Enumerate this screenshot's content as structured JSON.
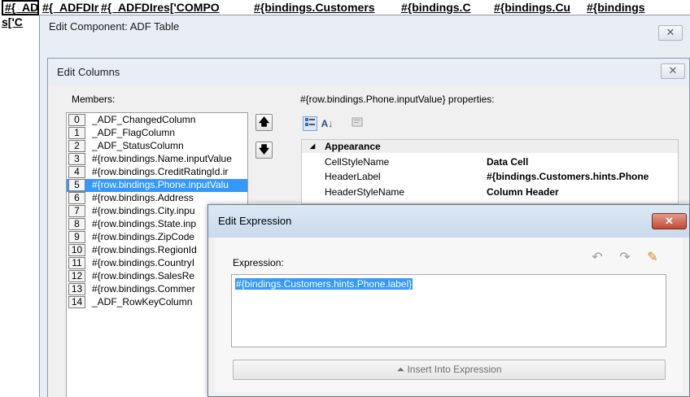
{
  "background_table": {
    "headers": [
      "#{_ADFDIre",
      "#{_ADFDIre",
      "#{_ADFDIres['COMPO",
      "#{bindings.Customers",
      "#{bindings.C",
      "#{bindings.Cu",
      "#{bindings"
    ],
    "row2_fragment": "s['C"
  },
  "outer_dialog": {
    "title": "Edit Component: ADF Table",
    "close_glyph": "✕"
  },
  "columns_dialog": {
    "title": "Edit Columns",
    "close_glyph": "✕",
    "members_label": "Members:",
    "members": [
      {
        "idx": "0",
        "text": "_ADF_ChangedColumn"
      },
      {
        "idx": "1",
        "text": "_ADF_FlagColumn"
      },
      {
        "idx": "2",
        "text": "_ADF_StatusColumn"
      },
      {
        "idx": "3",
        "text": "#{row.bindings.Name.inputValue"
      },
      {
        "idx": "4",
        "text": "#{row.bindings.CreditRatingId.ir"
      },
      {
        "idx": "5",
        "text": "#{row.bindings.Phone.inputValu"
      },
      {
        "idx": "6",
        "text": "#{row.bindings.Address"
      },
      {
        "idx": "7",
        "text": "#{row.bindings.City.inpu"
      },
      {
        "idx": "8",
        "text": "#{row.bindings.State.inp"
      },
      {
        "idx": "9",
        "text": "#{row.bindings.ZipCode"
      },
      {
        "idx": "10",
        "text": "#{row.bindings.RegionId"
      },
      {
        "idx": "11",
        "text": "#{row.bindings.CountryI"
      },
      {
        "idx": "12",
        "text": "#{row.bindings.SalesRe"
      },
      {
        "idx": "13",
        "text": "#{row.bindings.Commer"
      },
      {
        "idx": "14",
        "text": "_ADF_RowKeyColumn"
      }
    ],
    "selected_member": "5",
    "move_up_glyph": "🡅",
    "move_down_glyph": "🡇",
    "properties_label": "#{row.bindings.Phone.inputValue} properties:",
    "toolbar": {
      "categorized_icon": "categorized-icon",
      "sort_az_glyph": "A↓",
      "description_icon": "description-icon"
    },
    "properties": {
      "category_glyph": "◢",
      "category": "Appearance",
      "rows": [
        {
          "name": "CellStyleName",
          "value": "Data Cell"
        },
        {
          "name": "HeaderLabel",
          "value": "#{bindings.Customers.hints.Phone"
        },
        {
          "name": "HeaderStyleName",
          "value": "Column Header"
        }
      ]
    }
  },
  "expression_dialog": {
    "title": "Edit Expression",
    "close_glyph": "✕",
    "expression_label": "Expression:",
    "expression_value": "#{bindings.Customers.hints.Phone.label}",
    "undo_icon": "↶",
    "redo_icon": "↷",
    "clear_icon": "✎",
    "insert_label": "Insert Into Expression",
    "insert_glyph": "⏶"
  }
}
